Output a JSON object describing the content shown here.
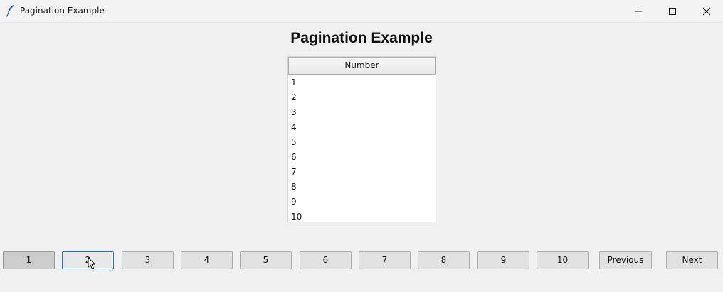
{
  "window": {
    "title": "Pagination Example",
    "app_icon": "feather-icon",
    "controls": [
      "minimize-icon",
      "maximize-icon",
      "close-icon"
    ]
  },
  "main": {
    "heading": "Pagination Example",
    "table": {
      "column_header": "Number",
      "rows": [
        "1",
        "2",
        "3",
        "4",
        "5",
        "6",
        "7",
        "8",
        "9",
        "10"
      ]
    }
  },
  "pagination": {
    "pages": [
      "1",
      "2",
      "3",
      "4",
      "5",
      "6",
      "7",
      "8",
      "9",
      "10"
    ],
    "current_page": "1",
    "hovered_page": "2",
    "previous_label": "Previous",
    "next_label": "Next"
  },
  "colors": {
    "window_background": "#f0f0f0",
    "button_face": "#e1e1e1",
    "button_pressed": "#cccccc",
    "focus_border": "#1a73e8"
  }
}
